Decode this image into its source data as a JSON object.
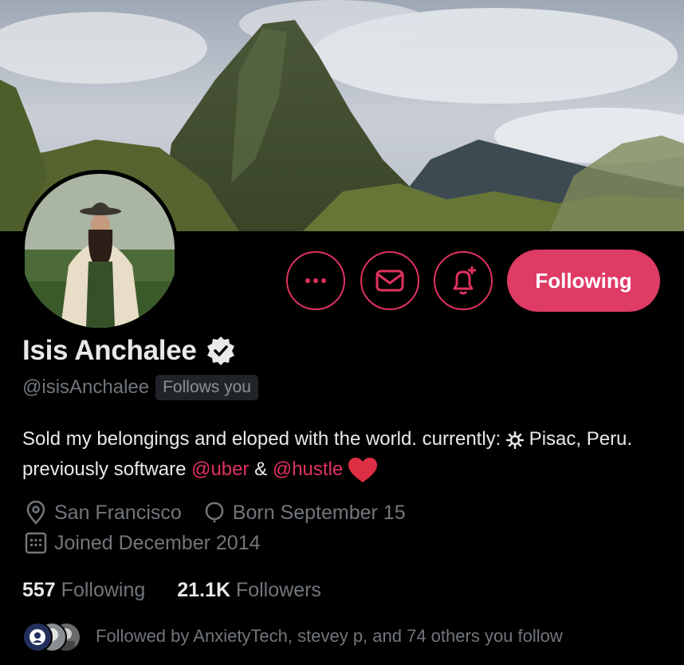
{
  "profile": {
    "name": "Isis Anchalee",
    "handle": "@isisAnchalee",
    "follows_you_badge": "Follows you",
    "verified_icon": "verified-badge-icon"
  },
  "actions": {
    "more_icon": "more-dots-icon",
    "message_icon": "mail-icon",
    "notify_icon": "bell-plus-icon",
    "follow_label": "Following"
  },
  "bio": {
    "part1": "Sold my belongings and eloped with the world. currently: ",
    "part2": " Pisac, Peru. previously software ",
    "mention1": "@uber",
    "amp": " & ",
    "mention2": "@hustle",
    "heart_icon": "red-heart-emoji"
  },
  "meta": {
    "location": "San Francisco",
    "birthday": "Born September 15",
    "joined": "Joined December 2014"
  },
  "stats": {
    "following_count": "557",
    "following_label": "Following",
    "followers_count": "21.1K",
    "followers_label": "Followers"
  },
  "followed_by": {
    "text": "Followed by AnxietyTech, stevey p, and 74 others you follow"
  },
  "colors": {
    "accent": "#de3b65",
    "background": "#000000",
    "secondary_text": "#71767b"
  }
}
